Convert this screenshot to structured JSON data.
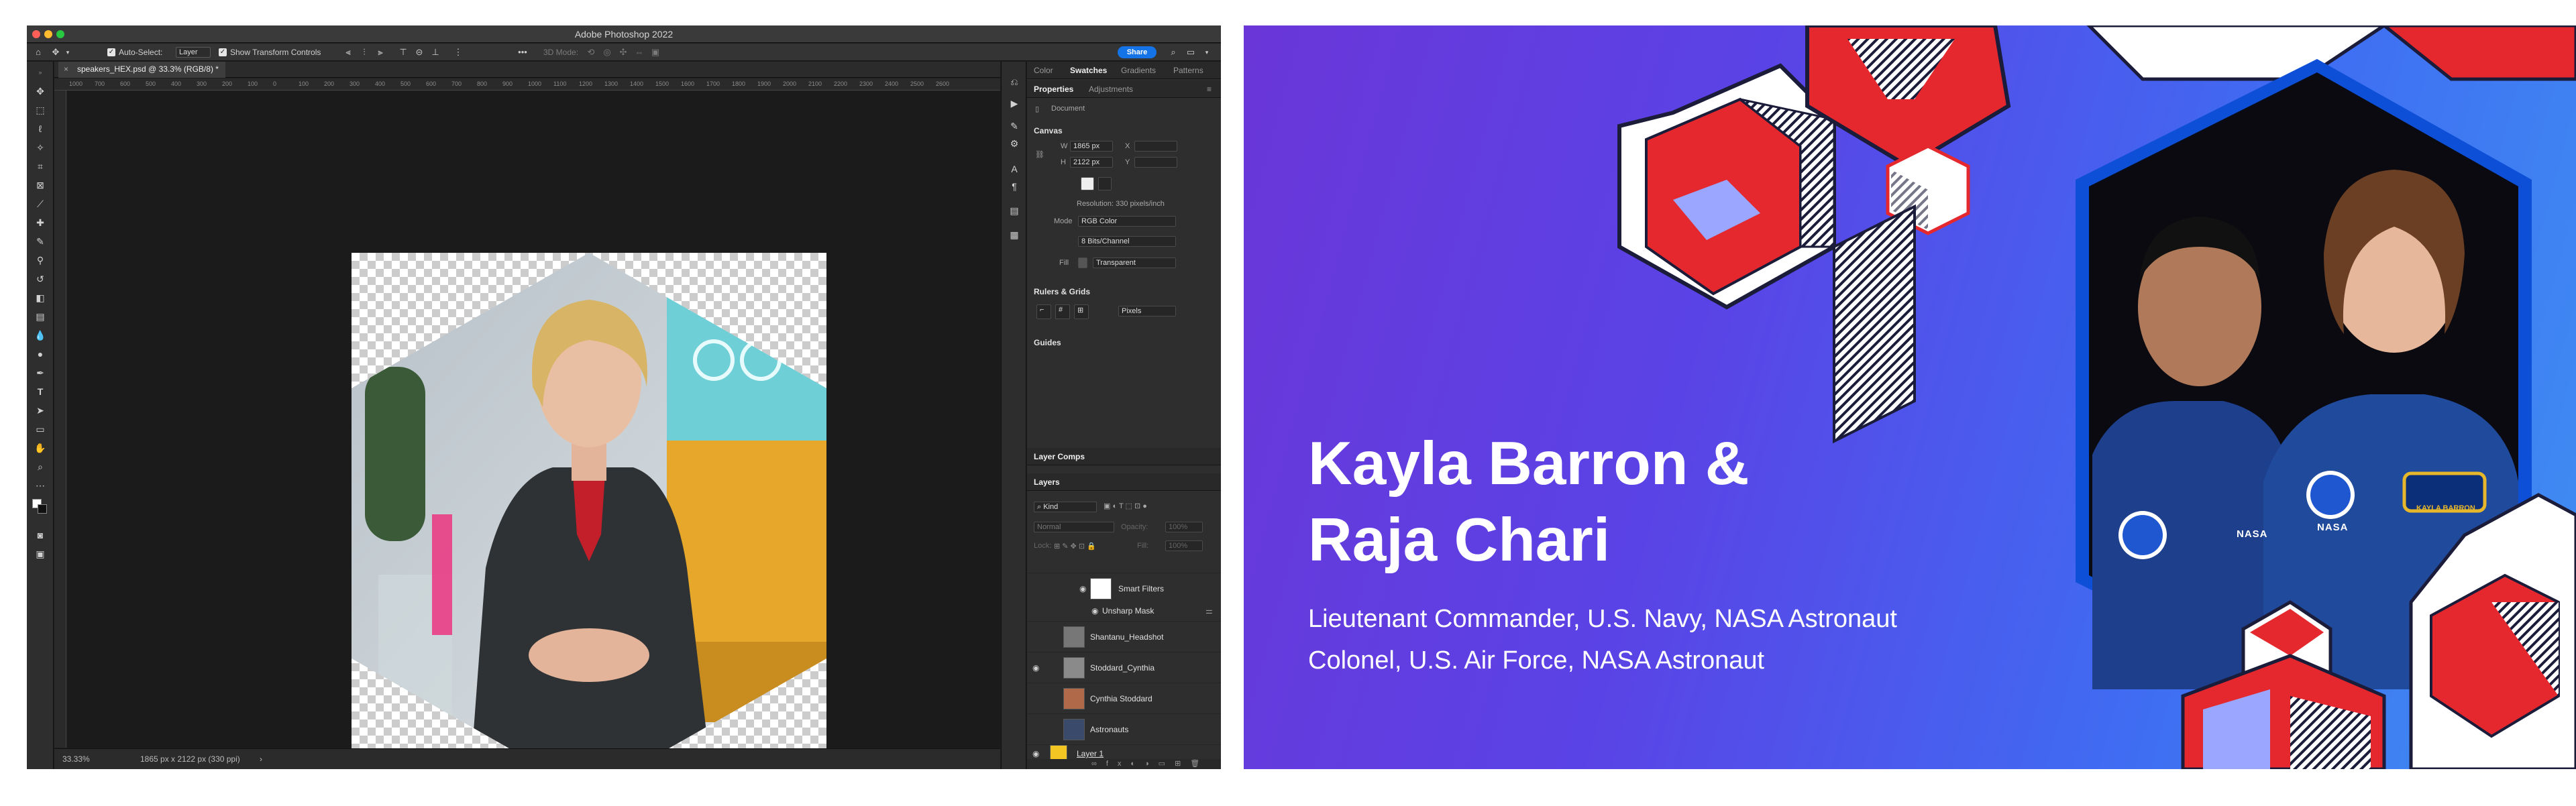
{
  "app": {
    "window_title": "Adobe Photoshop 2022",
    "options_bar": {
      "auto_select_label": "Auto-Select:",
      "auto_select_value": "Layer",
      "transform_label": "Show Transform Controls",
      "mode_3d": "3D Mode:",
      "share_label": "Share"
    },
    "document_tab": "speakers_HEX.psd @ 33.3% (RGB/8) *",
    "ruler_ticks": [
      "1000",
      "700",
      "600",
      "500",
      "400",
      "300",
      "200",
      "100",
      "0",
      "100",
      "200",
      "300",
      "400",
      "500",
      "600",
      "700",
      "800",
      "900",
      "1000",
      "1100",
      "1200",
      "1300",
      "1400",
      "1500",
      "1600",
      "1700",
      "1800",
      "1900",
      "2000",
      "2100",
      "2200",
      "2300",
      "2400",
      "2500",
      "2600"
    ],
    "status": {
      "zoom": "33.33%",
      "doc_info": "1865 px x 2122 px (330 ppi)"
    }
  },
  "panels": {
    "top_tabs": [
      "Color",
      "Swatches",
      "Gradients",
      "Patterns"
    ],
    "prop_tabs": [
      "Properties",
      "Adjustments"
    ],
    "doc_label": "Document",
    "canvas": {
      "title": "Canvas",
      "w_label": "W",
      "w_value": "1865 px",
      "h_label": "H",
      "h_value": "2122 px",
      "x_label": "X",
      "y_label": "Y",
      "resolution": "Resolution: 330 pixels/inch",
      "mode_label": "Mode",
      "mode_value": "RGB Color",
      "bits_value": "8 Bits/Channel",
      "fill_label": "Fill",
      "fill_value": "Transparent"
    },
    "rulers_grids": {
      "title": "Rulers & Grids",
      "units": "Pixels"
    },
    "guides_title": "Guides",
    "layer_comps": "Layer Comps",
    "layers_title": "Layers",
    "kind_label": "Kind",
    "blend_mode": "Normal",
    "opacity_label": "Opacity:",
    "opacity_value": "100%",
    "lock_label": "Lock:",
    "fill_label": "Fill:",
    "fill_value": "100%",
    "layers": [
      {
        "name": "Smart Filters"
      },
      {
        "name": "Unsharp Mask"
      },
      {
        "name": "Shantanu_Headshot"
      },
      {
        "name": "Stoddard_Cynthia"
      },
      {
        "name": "Cynthia Stoddard"
      },
      {
        "name": "Astronauts"
      },
      {
        "name": "Layer 1"
      }
    ]
  },
  "slide": {
    "name_line1": "Kayla Barron &",
    "name_line2": "Raja Chari",
    "role1": "Lieutenant Commander, U.S. Navy, NASA Astronaut",
    "role2": "Colonel, U.S. Air Force, NASA Astronaut",
    "patch_text": "NASA",
    "name_tag": "KAYLA BARRON"
  },
  "colors": {
    "accent": "#1473e6",
    "slide_purple": "#6a36d8",
    "slide_blue": "#3f8ff2",
    "hex_red": "#e5282d",
    "mustard": "#e6a72b"
  }
}
